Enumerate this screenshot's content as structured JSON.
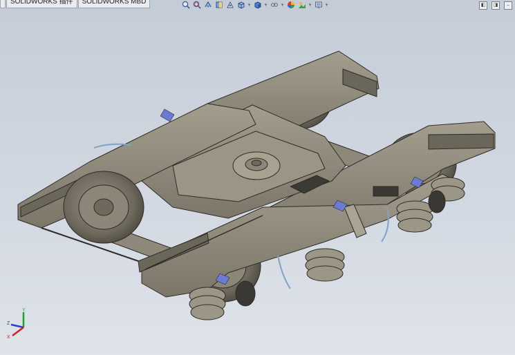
{
  "command_tabs": {
    "first_label": "",
    "addins_label": "SOLIDWORKS 插件",
    "mbd_label": "SOLIDWORKS MBD"
  },
  "heads_up_toolbar": {
    "icons": [
      "zoom-to-fit-icon",
      "zoom-to-area-icon",
      "previous-view-icon",
      "section-view-icon",
      "dynamic-annotation-icon",
      "view-orientation-icon",
      "display-style-icon",
      "hide-show-items-icon",
      "edit-appearance-icon",
      "apply-scene-icon",
      "view-settings-icon"
    ]
  },
  "window_controls": {
    "icons": [
      "restore-icon",
      "maximize-icon",
      "close-icon"
    ]
  },
  "model": {
    "name": "bogie-assembly",
    "colors": {
      "body": "#8c8678",
      "edge": "#2f2c27",
      "shadow": "#5e5a51",
      "light": "#a9a394",
      "accent_blue": "#6a7bd6",
      "hose_blue": "#7fa2c8"
    }
  },
  "triad": {
    "x_label": "X",
    "y_label": "Y",
    "z_label": "Z",
    "colors": {
      "x": "#d22020",
      "y": "#21a32b",
      "z": "#2b3bd4"
    }
  }
}
